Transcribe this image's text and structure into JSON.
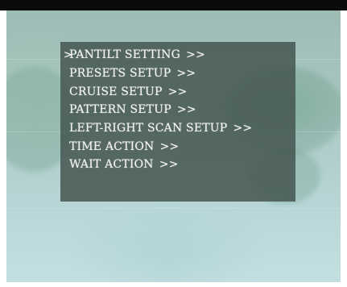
{
  "menu": {
    "cursor_symbol": ">",
    "items": [
      {
        "label": "PANTILT SETTING",
        "arrow": ">>",
        "selected": true
      },
      {
        "label": "PRESETS SETUP",
        "arrow": ">>",
        "selected": false
      },
      {
        "label": "CRUISE SETUP",
        "arrow": ">>",
        "selected": false
      },
      {
        "label": "PATTERN SETUP",
        "arrow": ">>",
        "selected": false
      },
      {
        "label": "LEFT-RIGHT SCAN SETUP",
        "arrow": ">>",
        "selected": false
      },
      {
        "label": "TIME ACTION",
        "arrow": ">>",
        "selected": false
      },
      {
        "label": "WAIT ACTION",
        "arrow": ">>",
        "selected": false
      }
    ]
  },
  "colors": {
    "text": "#f4f4f4",
    "panel": "#465652",
    "background": "#a9c7c1",
    "top_bar": "#0b0b0b"
  }
}
